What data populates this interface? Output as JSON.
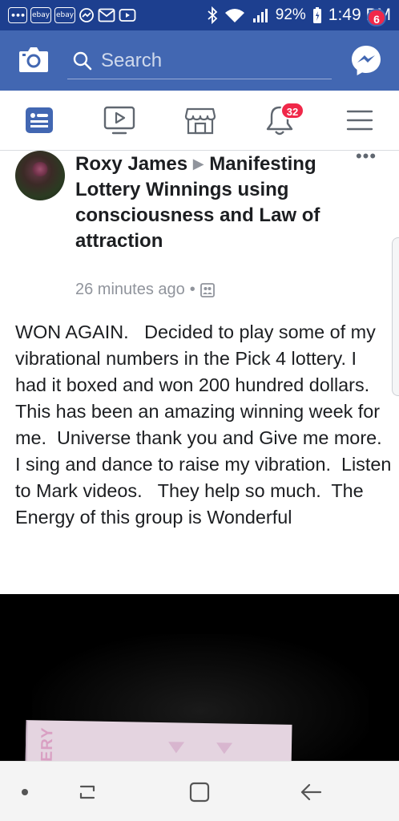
{
  "status_bar": {
    "notifications": [
      "•••",
      "ebay",
      "ebay",
      "messenger-icon",
      "gmail-icon",
      "youtube-icon"
    ],
    "battery": "92%",
    "time": "1:49 PM"
  },
  "header": {
    "search_placeholder": "Search",
    "messenger_badge": "6"
  },
  "tabs": {
    "notifications_badge": "32"
  },
  "post": {
    "author": "Roxy James",
    "group": "Manifesting Lottery Winnings using consciousness and Law of attraction",
    "timestamp": "26 minutes ago",
    "text": "WON AGAIN.   Decided to play some of my vibrational numbers in the Pick 4 lottery. I had it boxed and won 200 hundred dollars.   This has been an amazing winning week for me.  Universe thank you and Give me more.  I sing and dance to raise my vibration.  Listen to Mark videos.   They help so much.  The Energy of this group is Wonderful",
    "photo_text": "TERY"
  },
  "colors": {
    "status_bar": "#1d3f8f",
    "header": "#4267b2",
    "active_tab": "#4267b2",
    "badge": "#f02849"
  }
}
